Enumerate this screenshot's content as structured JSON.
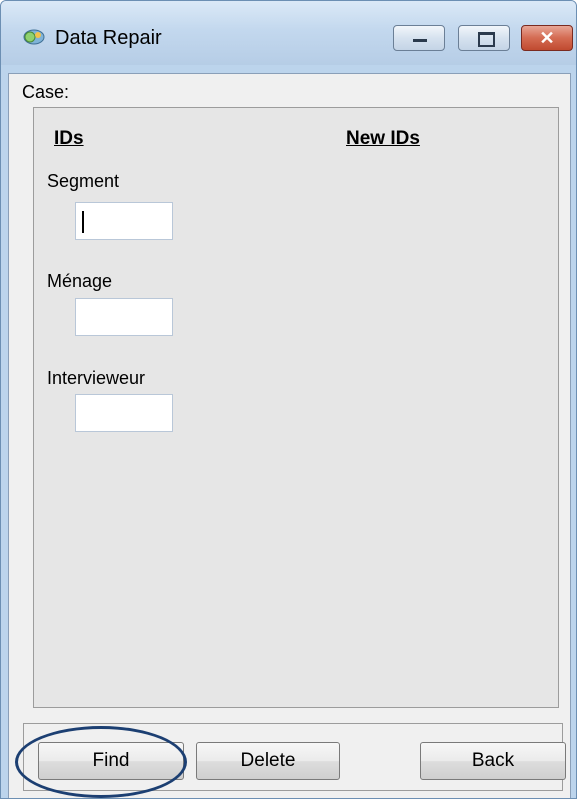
{
  "window": {
    "title": "Data Repair",
    "controls": {
      "minimize": "minimize",
      "maximize": "maximize",
      "close": "x"
    },
    "close_color": "#c8563c"
  },
  "form": {
    "case_label": "Case:",
    "headers": {
      "ids": "IDs",
      "new_ids": "New IDs"
    },
    "fields": [
      {
        "label": "Segment",
        "value": ""
      },
      {
        "label": "Ménage",
        "value": ""
      },
      {
        "label": "Intervieweur",
        "value": ""
      }
    ]
  },
  "buttons": {
    "find": "Find",
    "delete": "Delete",
    "back": "Back"
  },
  "annotation": {
    "highlight_color": "#1c3f72",
    "highlighted": "Find"
  },
  "icons": [
    "app-icon",
    "minimize-icon",
    "maximize-icon",
    "close-icon"
  ]
}
